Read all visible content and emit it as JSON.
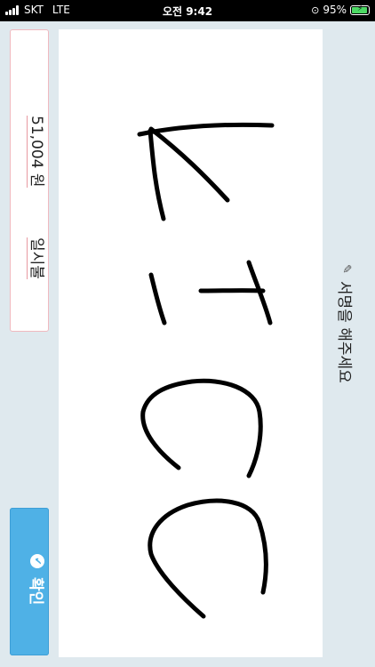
{
  "status": {
    "carrier": "SKT",
    "network": "LTE",
    "time": "오전 9:42",
    "battery": "95%"
  },
  "payment": {
    "amount": "51,004 원",
    "installment": "일시불"
  },
  "confirm": {
    "label": "확인",
    "icon": "check-circle-icon"
  },
  "instruction": {
    "text": "서명을 해주세요",
    "icon": "pencil-icon"
  },
  "colors": {
    "background": "#dfe9ee",
    "confirm_button": "#4fb1e6",
    "card_border": "#f0b9bf",
    "ink": "#000000"
  }
}
